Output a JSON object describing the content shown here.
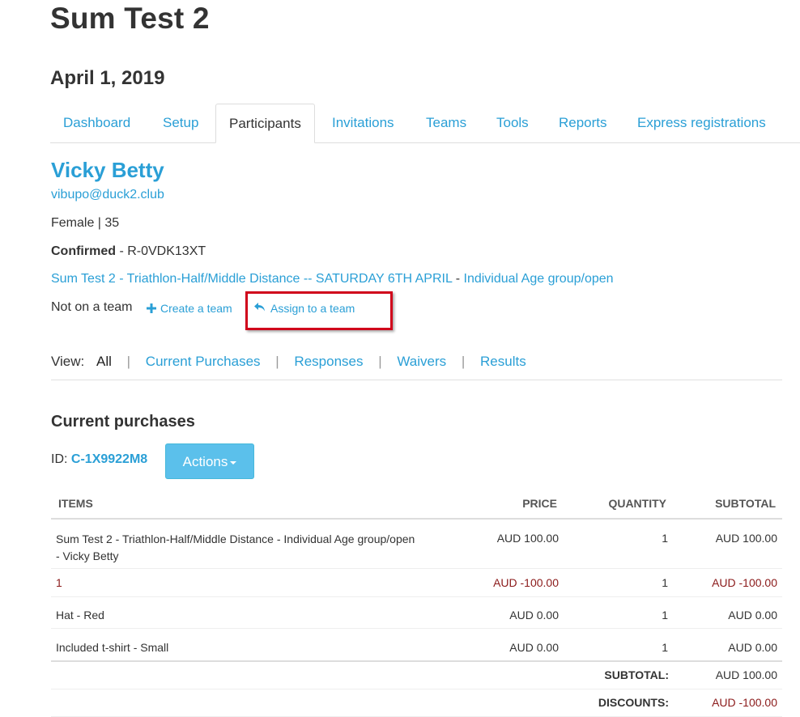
{
  "event": {
    "title": "Sum Test 2",
    "date": "April 1, 2019"
  },
  "tabs": [
    {
      "label": "Dashboard"
    },
    {
      "label": "Setup"
    },
    {
      "label": "Participants",
      "active": true
    },
    {
      "label": "Invitations"
    },
    {
      "label": "Teams"
    },
    {
      "label": "Tools"
    },
    {
      "label": "Reports"
    },
    {
      "label": "Express registrations"
    }
  ],
  "participant": {
    "name": "Vicky Betty",
    "email": "vibupo@duck2.club",
    "meta": "Female | 35",
    "status_label": "Confirmed",
    "status_sep": " - ",
    "reference": "R-0VDK13XT",
    "event_link": "Sum Test 2 - Triathlon-Half/Middle Distance -- SATURDAY 6TH APRIL",
    "reg_sep": " - ",
    "category_link": "Individual Age group/open"
  },
  "team": {
    "status": "Not on a team",
    "create_label": "Create a team",
    "assign_label": "Assign to a team"
  },
  "view": {
    "label": "View:",
    "items": [
      "All",
      "Current Purchases",
      "Responses",
      "Waivers",
      "Results"
    ]
  },
  "purchases": {
    "title": "Current purchases",
    "id_label": "ID:",
    "id_value": "C-1X9922M8",
    "actions_label": "Actions",
    "headers": {
      "items": "ITEMS",
      "price": "PRICE",
      "quantity": "QUANTITY",
      "subtotal": "SUBTOTAL"
    },
    "rows": [
      {
        "item_line1": "Sum Test 2 - Triathlon-Half/Middle Distance - Individual Age group/open",
        "item_line2": "- Vicky Betty",
        "price": "AUD 100.00",
        "qty": "1",
        "subtotal": "AUD 100.00",
        "negative": false
      },
      {
        "item_line1": "1",
        "item_line2": "",
        "price": "AUD -100.00",
        "qty": "1",
        "subtotal": "AUD -100.00",
        "negative": true
      },
      {
        "item_line1": "Hat - Red",
        "item_line2": "",
        "price": "AUD 0.00",
        "qty": "1",
        "subtotal": "AUD 0.00",
        "negative": false
      },
      {
        "item_line1": "Included t-shirt - Small",
        "item_line2": "",
        "price": "AUD 0.00",
        "qty": "1",
        "subtotal": "AUD 0.00",
        "negative": false
      }
    ],
    "totals": {
      "subtotal_label": "SUBTOTAL:",
      "subtotal_value": "AUD 100.00",
      "discounts_label": "DISCOUNTS:",
      "discounts_value": "AUD -100.00"
    }
  },
  "colors": {
    "link": "#2a9fd6",
    "highlight": "#d0021b",
    "button": "#5bc0eb",
    "negative": "#8b1a1a"
  }
}
